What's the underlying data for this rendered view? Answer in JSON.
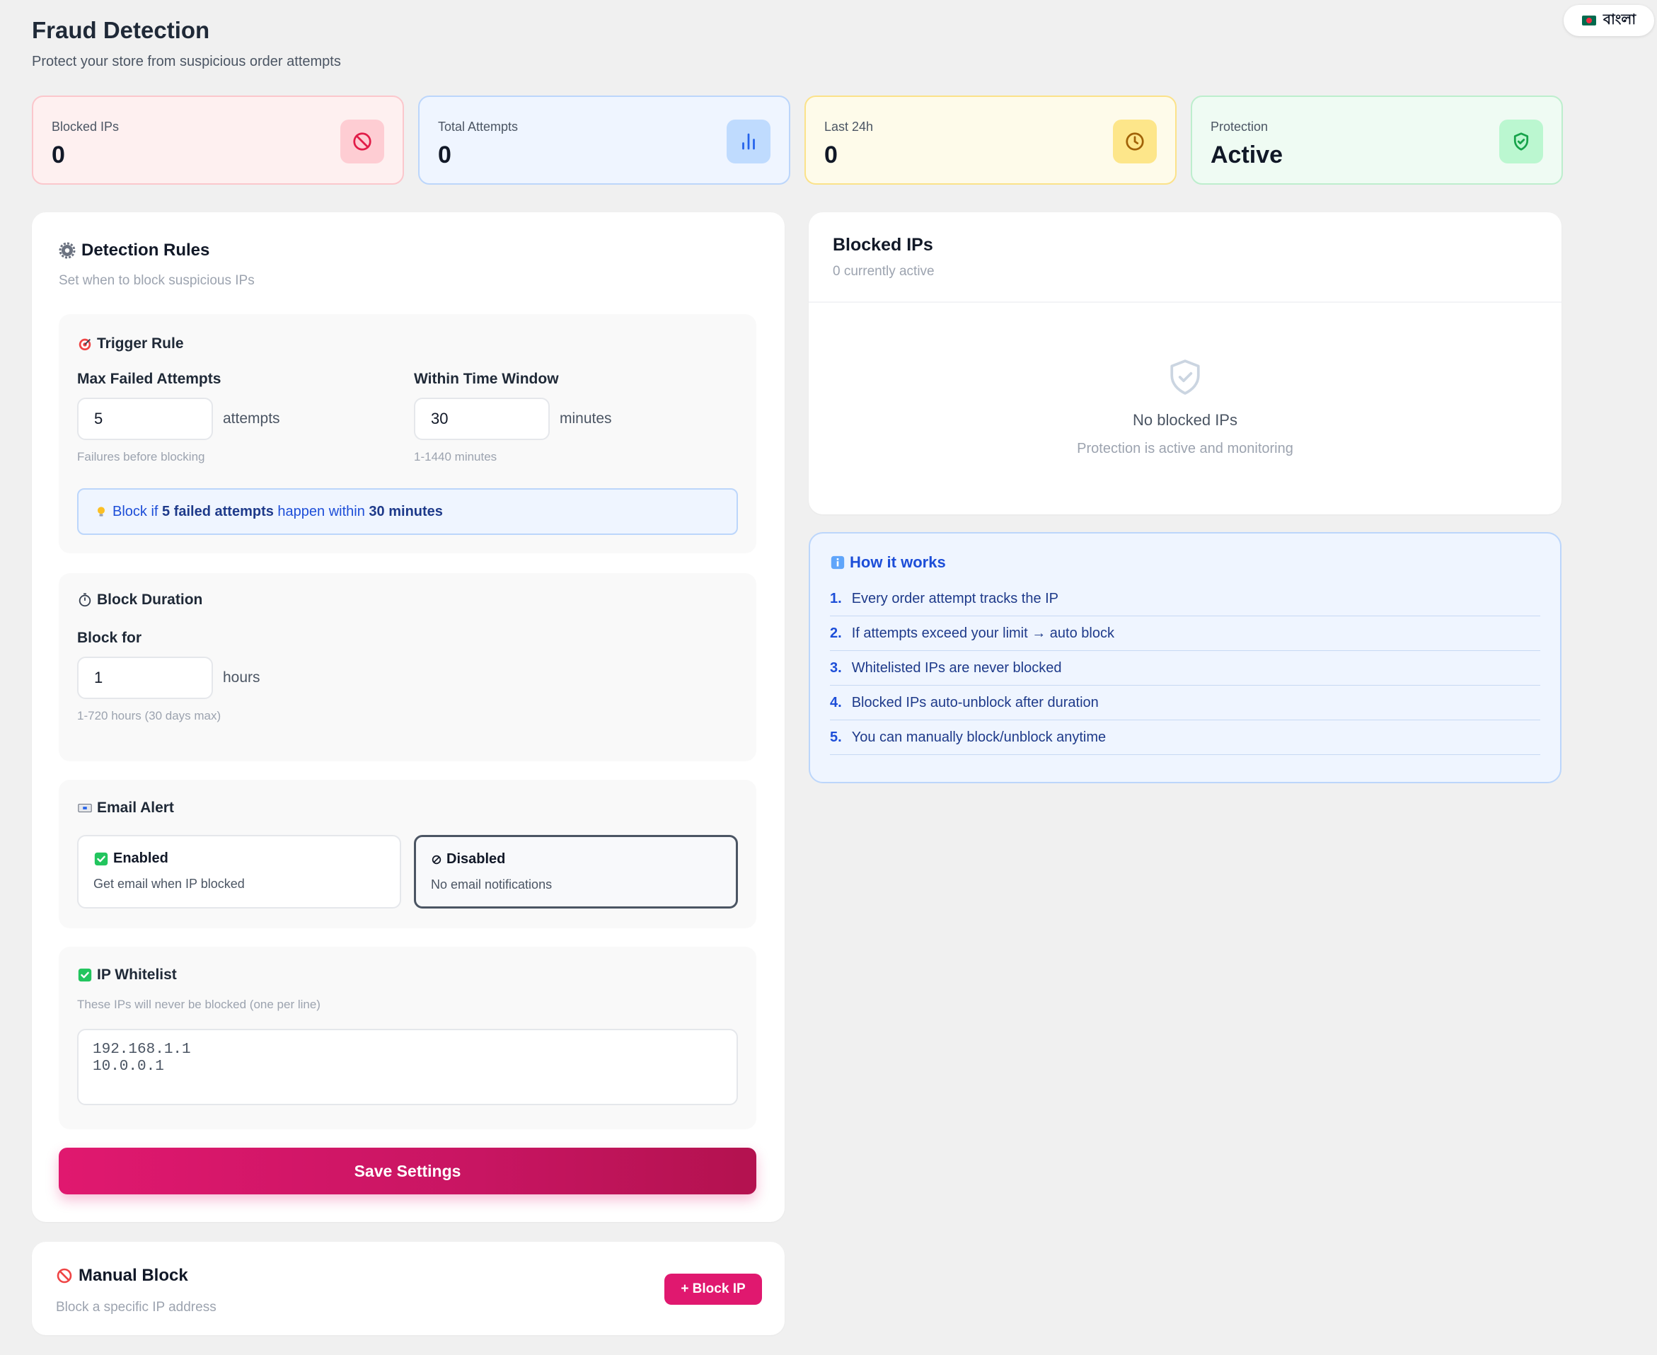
{
  "header": {
    "title": "Fraud Detection",
    "subtitle": "Protect your store from suspicious order attempts",
    "language_button": "বাংলা"
  },
  "stats": [
    {
      "label": "Blocked IPs",
      "value": "0",
      "icon": "ban-icon",
      "color": "#e11d48"
    },
    {
      "label": "Total Attempts",
      "value": "0",
      "icon": "bar-chart-icon",
      "color": "#2563eb"
    },
    {
      "label": "Last 24h",
      "value": "0",
      "icon": "clock-icon",
      "color": "#a16207"
    },
    {
      "label": "Protection",
      "value": "Active",
      "icon": "shield-check-icon",
      "color": "#16a34a"
    }
  ],
  "rules": {
    "title": "Detection Rules",
    "subtitle": "Set when to block suspicious IPs",
    "trigger": {
      "title": "Trigger Rule",
      "max_label": "Max Failed Attempts",
      "max_value": "5",
      "max_unit": "attempts",
      "max_hint": "Failures before blocking",
      "window_label": "Within Time Window",
      "window_value": "30",
      "window_unit": "minutes",
      "window_hint": "1-1440 minutes",
      "summary_prefix": "Block if",
      "summary_attempts": "5 failed attempts",
      "summary_middle": "happen within",
      "summary_window": "30 minutes"
    },
    "duration": {
      "title": "Block Duration",
      "label": "Block for",
      "value": "1",
      "unit": "hours",
      "hint": "1-720 hours (30 days max)"
    },
    "email": {
      "title": "Email Alert",
      "enabled_title": "Enabled",
      "enabled_desc": "Get email when IP blocked",
      "disabled_title": "Disabled",
      "disabled_desc": "No email notifications",
      "selected": "Disabled"
    },
    "whitelist": {
      "title": "IP Whitelist",
      "desc": "These IPs will never be blocked (one per line)",
      "value": "192.168.1.1\n10.0.0.1"
    },
    "save_label": "Save Settings"
  },
  "manual": {
    "title": "Manual Block",
    "desc": "Block a specific IP address",
    "button": "+ Block IP"
  },
  "blocked": {
    "title": "Blocked IPs",
    "subtitle": "0 currently active",
    "empty_title": "No blocked IPs",
    "empty_desc": "Protection is active and monitoring"
  },
  "how": {
    "title": "How it works",
    "items": [
      {
        "num": "1.",
        "text": "Every order attempt tracks the IP"
      },
      {
        "num": "2.",
        "text": "If attempts exceed your limit → auto block"
      },
      {
        "num": "3.",
        "text": "Whitelisted IPs are never blocked"
      },
      {
        "num": "4.",
        "text": "Blocked IPs auto-unblock after duration"
      },
      {
        "num": "5.",
        "text": "You can manually block/unblock anytime"
      }
    ]
  },
  "colors": {
    "accent": "#e0186f",
    "info_blue": "#1d4ed8"
  }
}
